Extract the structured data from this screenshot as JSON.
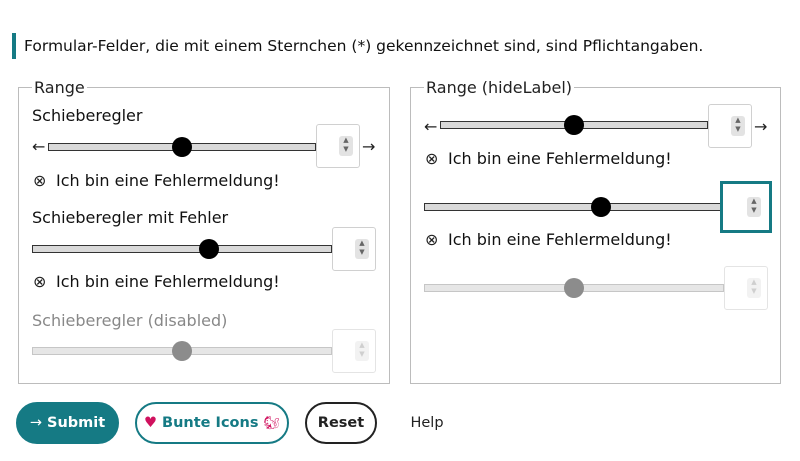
{
  "notice": "Formular-Felder, die mit einem Sternchen (*) gekennzeichnet sind, sind Pflichtangaben.",
  "left": {
    "legend": "Range",
    "slider1": {
      "label": "Schieberegler",
      "start_arrow": "←",
      "end_arrow": "→",
      "value_fraction": 0.5,
      "error": "Ich bin eine Fehlermeldung!"
    },
    "slider2": {
      "label": "Schieberegler mit Fehler",
      "value_fraction": 0.59,
      "error": "Ich bin eine Fehlermeldung!"
    },
    "slider3": {
      "label": "Schieberegler (disabled)",
      "value_fraction": 0.5
    }
  },
  "right": {
    "legend": "Range (hideLabel)",
    "slider1": {
      "start_arrow": "←",
      "end_arrow": "→",
      "value_fraction": 0.5,
      "error": "Ich bin eine Fehlermeldung!"
    },
    "slider2": {
      "value_fraction": 0.59,
      "error": "Ich bin eine Fehlermeldung!"
    },
    "slider3": {
      "value_fraction": 0.5
    }
  },
  "icons": {
    "error": "⊗",
    "spin_up": "▲",
    "spin_down": "▼",
    "submit_arrow": "→",
    "heart": "♥",
    "squirrel": "🐿"
  },
  "buttons": {
    "submit": "Submit",
    "bunte_icons": "Bunte Icons",
    "reset": "Reset",
    "help": "Help"
  },
  "colors": {
    "accent": "#157a84",
    "heart": "#d0115e"
  }
}
